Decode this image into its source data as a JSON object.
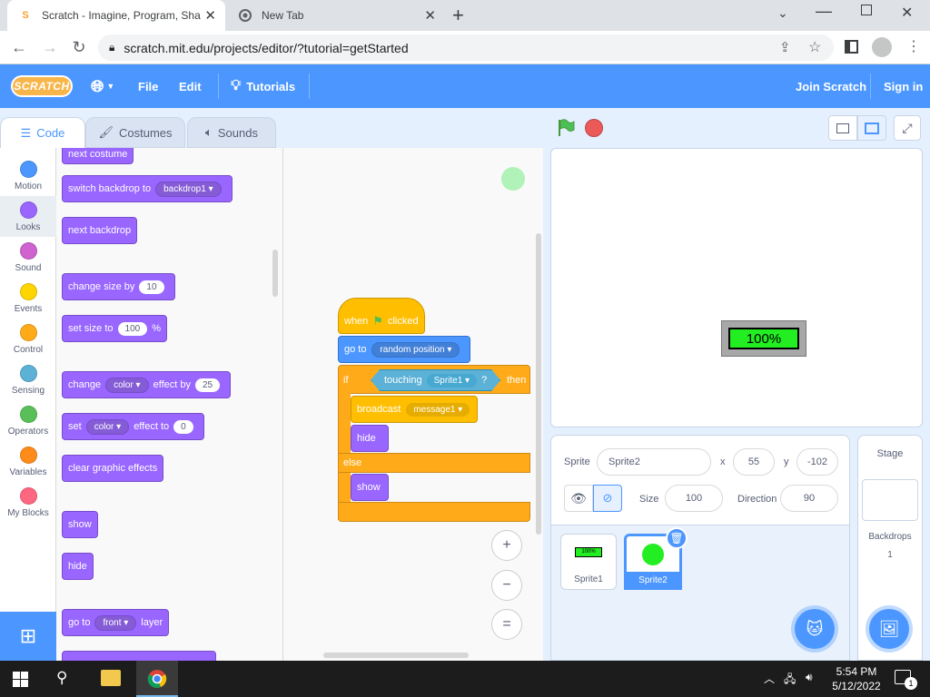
{
  "browser": {
    "tabs": [
      {
        "title": "Scratch - Imagine, Program, Sha"
      },
      {
        "title": "New Tab"
      }
    ],
    "url": "scratch.mit.edu/projects/editor/?tutorial=getStarted"
  },
  "menu": {
    "logo": "SCRATCH",
    "file": "File",
    "edit": "Edit",
    "tutorials": "Tutorials",
    "join": "Join Scratch",
    "signin": "Sign in"
  },
  "editor_tabs": {
    "code": "Code",
    "costumes": "Costumes",
    "sounds": "Sounds"
  },
  "categories": [
    {
      "label": "Motion",
      "color": "#4c97ff"
    },
    {
      "label": "Looks",
      "color": "#9966ff"
    },
    {
      "label": "Sound",
      "color": "#cf63cf"
    },
    {
      "label": "Events",
      "color": "#ffd500"
    },
    {
      "label": "Control",
      "color": "#ffab19"
    },
    {
      "label": "Sensing",
      "color": "#5cb1d6"
    },
    {
      "label": "Operators",
      "color": "#59c059"
    },
    {
      "label": "Variables",
      "color": "#ff8c1a"
    },
    {
      "label": "My Blocks",
      "color": "#ff6680"
    }
  ],
  "palette": {
    "next_costume": "next costume",
    "switch_backdrop": "switch backdrop to",
    "backdrop1": "backdrop1",
    "next_backdrop": "next backdrop",
    "change_size": "change size by",
    "change_size_val": "10",
    "set_size": "set size to",
    "set_size_val": "100",
    "percent": "%",
    "change": "change",
    "color": "color",
    "effect_by": "effect by",
    "effect_by_val": "25",
    "set": "set",
    "effect_to": "effect to",
    "effect_to_val": "0",
    "clear_effects": "clear graphic effects",
    "show": "show",
    "hide": "hide",
    "go_to": "go to",
    "front": "front",
    "layer": "layer"
  },
  "script": {
    "when": "when",
    "clicked": "clicked",
    "go_to": "go to",
    "random_position": "random position",
    "if": "if",
    "touching": "touching",
    "sprite1": "Sprite1",
    "q": "?",
    "then": "then",
    "broadcast": "broadcast",
    "message1": "message1",
    "hide": "hide",
    "else": "else",
    "show": "show"
  },
  "zoom": {
    "in": "+",
    "out": "−",
    "reset": "="
  },
  "stage": {
    "display_text": "100%"
  },
  "sprite_info": {
    "sprite_label": "Sprite",
    "sprite_name": "Sprite2",
    "x_label": "x",
    "x": "55",
    "y_label": "y",
    "y": "-102",
    "size_label": "Size",
    "size": "100",
    "direction_label": "Direction",
    "direction": "90"
  },
  "sprites": [
    {
      "name": "Sprite1",
      "thumb_text": "100%"
    },
    {
      "name": "Sprite2"
    }
  ],
  "stage_panel": {
    "title": "Stage",
    "backdrops_label": "Backdrops",
    "backdrops_count": "1"
  },
  "taskbar": {
    "time": "5:54 PM",
    "date": "5/12/2022",
    "notif": "1"
  }
}
